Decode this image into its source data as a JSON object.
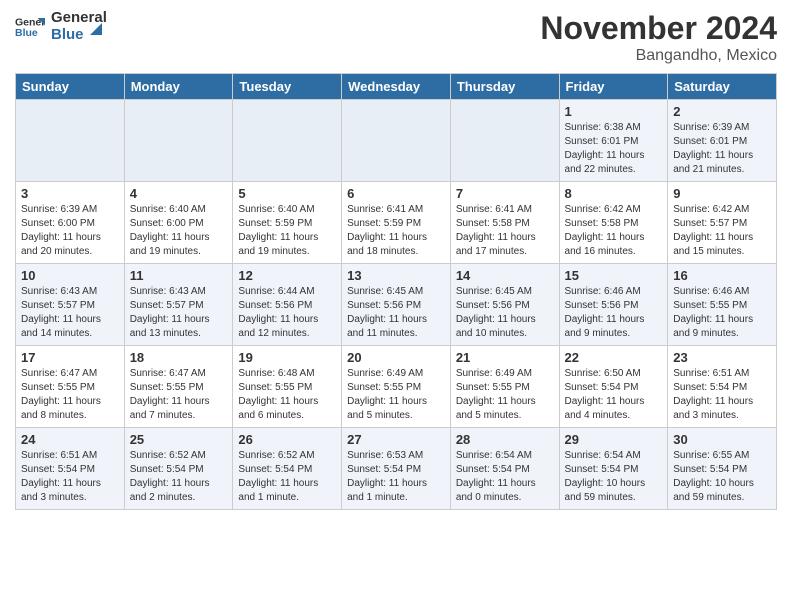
{
  "header": {
    "logo_general": "General",
    "logo_blue": "Blue",
    "month_title": "November 2024",
    "location": "Bangandho, Mexico"
  },
  "weekdays": [
    "Sunday",
    "Monday",
    "Tuesday",
    "Wednesday",
    "Thursday",
    "Friday",
    "Saturday"
  ],
  "weeks": [
    [
      {
        "day": "",
        "info": ""
      },
      {
        "day": "",
        "info": ""
      },
      {
        "day": "",
        "info": ""
      },
      {
        "day": "",
        "info": ""
      },
      {
        "day": "",
        "info": ""
      },
      {
        "day": "1",
        "info": "Sunrise: 6:38 AM\nSunset: 6:01 PM\nDaylight: 11 hours and 22 minutes."
      },
      {
        "day": "2",
        "info": "Sunrise: 6:39 AM\nSunset: 6:01 PM\nDaylight: 11 hours and 21 minutes."
      }
    ],
    [
      {
        "day": "3",
        "info": "Sunrise: 6:39 AM\nSunset: 6:00 PM\nDaylight: 11 hours and 20 minutes."
      },
      {
        "day": "4",
        "info": "Sunrise: 6:40 AM\nSunset: 6:00 PM\nDaylight: 11 hours and 19 minutes."
      },
      {
        "day": "5",
        "info": "Sunrise: 6:40 AM\nSunset: 5:59 PM\nDaylight: 11 hours and 19 minutes."
      },
      {
        "day": "6",
        "info": "Sunrise: 6:41 AM\nSunset: 5:59 PM\nDaylight: 11 hours and 18 minutes."
      },
      {
        "day": "7",
        "info": "Sunrise: 6:41 AM\nSunset: 5:58 PM\nDaylight: 11 hours and 17 minutes."
      },
      {
        "day": "8",
        "info": "Sunrise: 6:42 AM\nSunset: 5:58 PM\nDaylight: 11 hours and 16 minutes."
      },
      {
        "day": "9",
        "info": "Sunrise: 6:42 AM\nSunset: 5:57 PM\nDaylight: 11 hours and 15 minutes."
      }
    ],
    [
      {
        "day": "10",
        "info": "Sunrise: 6:43 AM\nSunset: 5:57 PM\nDaylight: 11 hours and 14 minutes."
      },
      {
        "day": "11",
        "info": "Sunrise: 6:43 AM\nSunset: 5:57 PM\nDaylight: 11 hours and 13 minutes."
      },
      {
        "day": "12",
        "info": "Sunrise: 6:44 AM\nSunset: 5:56 PM\nDaylight: 11 hours and 12 minutes."
      },
      {
        "day": "13",
        "info": "Sunrise: 6:45 AM\nSunset: 5:56 PM\nDaylight: 11 hours and 11 minutes."
      },
      {
        "day": "14",
        "info": "Sunrise: 6:45 AM\nSunset: 5:56 PM\nDaylight: 11 hours and 10 minutes."
      },
      {
        "day": "15",
        "info": "Sunrise: 6:46 AM\nSunset: 5:56 PM\nDaylight: 11 hours and 9 minutes."
      },
      {
        "day": "16",
        "info": "Sunrise: 6:46 AM\nSunset: 5:55 PM\nDaylight: 11 hours and 9 minutes."
      }
    ],
    [
      {
        "day": "17",
        "info": "Sunrise: 6:47 AM\nSunset: 5:55 PM\nDaylight: 11 hours and 8 minutes."
      },
      {
        "day": "18",
        "info": "Sunrise: 6:47 AM\nSunset: 5:55 PM\nDaylight: 11 hours and 7 minutes."
      },
      {
        "day": "19",
        "info": "Sunrise: 6:48 AM\nSunset: 5:55 PM\nDaylight: 11 hours and 6 minutes."
      },
      {
        "day": "20",
        "info": "Sunrise: 6:49 AM\nSunset: 5:55 PM\nDaylight: 11 hours and 5 minutes."
      },
      {
        "day": "21",
        "info": "Sunrise: 6:49 AM\nSunset: 5:55 PM\nDaylight: 11 hours and 5 minutes."
      },
      {
        "day": "22",
        "info": "Sunrise: 6:50 AM\nSunset: 5:54 PM\nDaylight: 11 hours and 4 minutes."
      },
      {
        "day": "23",
        "info": "Sunrise: 6:51 AM\nSunset: 5:54 PM\nDaylight: 11 hours and 3 minutes."
      }
    ],
    [
      {
        "day": "24",
        "info": "Sunrise: 6:51 AM\nSunset: 5:54 PM\nDaylight: 11 hours and 3 minutes."
      },
      {
        "day": "25",
        "info": "Sunrise: 6:52 AM\nSunset: 5:54 PM\nDaylight: 11 hours and 2 minutes."
      },
      {
        "day": "26",
        "info": "Sunrise: 6:52 AM\nSunset: 5:54 PM\nDaylight: 11 hours and 1 minute."
      },
      {
        "day": "27",
        "info": "Sunrise: 6:53 AM\nSunset: 5:54 PM\nDaylight: 11 hours and 1 minute."
      },
      {
        "day": "28",
        "info": "Sunrise: 6:54 AM\nSunset: 5:54 PM\nDaylight: 11 hours and 0 minutes."
      },
      {
        "day": "29",
        "info": "Sunrise: 6:54 AM\nSunset: 5:54 PM\nDaylight: 10 hours and 59 minutes."
      },
      {
        "day": "30",
        "info": "Sunrise: 6:55 AM\nSunset: 5:54 PM\nDaylight: 10 hours and 59 minutes."
      }
    ]
  ]
}
